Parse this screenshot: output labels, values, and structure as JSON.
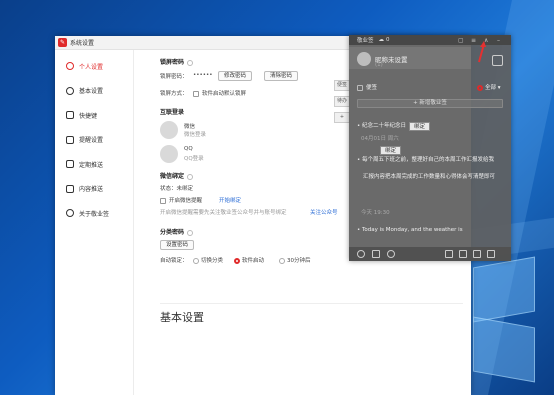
{
  "window": {
    "title": "系统设置",
    "app_icon": "app-logo-icon",
    "accent_color": "#e02a2a"
  },
  "sidebar": {
    "items": [
      {
        "label": "个人设置",
        "icon": "person-icon"
      },
      {
        "label": "基本设置",
        "icon": "settings-icon"
      },
      {
        "label": "快捷键",
        "icon": "keyboard-icon"
      },
      {
        "label": "提醒设置",
        "icon": "bell-icon"
      },
      {
        "label": "定期推送",
        "icon": "push-icon"
      },
      {
        "label": "内容推送",
        "icon": "document-icon"
      },
      {
        "label": "关于敬业签",
        "icon": "info-icon"
      }
    ]
  },
  "lock": {
    "title": "锁屏密码",
    "pwd_label": "锁屏密码：",
    "pwd_value": "••••••",
    "modify_btn": "修改密码",
    "clear_btn": "清除密码",
    "mode_label": "锁屏方式：",
    "auto_lock": "软件启动默认锁屏"
  },
  "login": {
    "title": "互联登录",
    "wechat_name": "微信",
    "wechat_status": "微信登录",
    "qq_name": "QQ",
    "qq_status": "QQ登录"
  },
  "wxbind": {
    "title": "微信绑定",
    "status": "状态：未绑定",
    "enable_label": "开启微信提醒",
    "enable_link": "开始绑定",
    "hint": "开启微信提醒需要先关注敬业签公众号并与账号绑定",
    "hint_link": "关注公众号"
  },
  "category": {
    "title": "分类密码",
    "set_btn": "设置密码",
    "autolock_label": "自动锁定：",
    "options": [
      "切换分类",
      "软件启动",
      "30分钟后"
    ]
  },
  "basic": {
    "title": "基本设置"
  },
  "note": {
    "title": "敬业签",
    "count": "0",
    "user": "昵称未设置",
    "user_sub": "(1)",
    "filter": "全部",
    "category_label": "便签",
    "new_btn": "+ 新增敬业签",
    "items": [
      {
        "text": "纪念二十年纪念日",
        "date": "04月01日 周六"
      },
      {
        "text": "每个周五下班之前，整理好自己的本周工作汇报发给我",
        "extra": "汇报内容把本周完成的工作数量和心得体会写清楚即可",
        "date": "今天 19:30"
      },
      {
        "text": "Today is Monday, and the weather is"
      }
    ],
    "bind_btn": "绑定",
    "side_tabs": [
      "便签",
      "待办"
    ]
  }
}
